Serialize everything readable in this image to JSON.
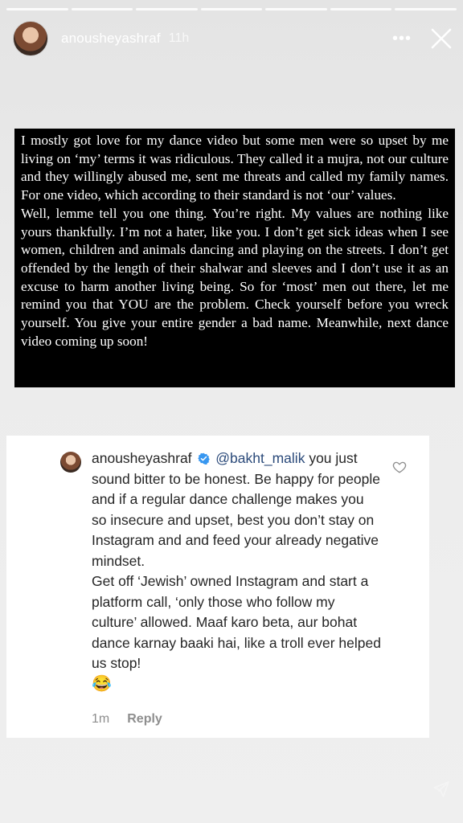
{
  "story": {
    "username": "anousheyashraf",
    "time": "11h",
    "progress_segments": 7
  },
  "quote": {
    "paragraphs": [
      "I mostly got love for my dance video but some men were so upset by me living on ‘my’ terms it was ridiculous. They called it a mujra, not our culture and they willingly abused me, sent me threats and called my family names. For one video, which according to their standard is not ‘our’ values.",
      "Well, lemme tell you one thing. You’re right. My values are nothing like yours thankfully. I’m not a hater, like you. I don’t get sick ideas when I see women, children and animals dancing and playing on the streets. I don’t get offended by the length of their shalwar and sleeves and I don’t use it as an excuse to harm another living being. So for ‘most’ men out there, let me remind you that YOU are the problem. Check yourself before you wreck yourself. You give your entire gender a bad name. Meanwhile, next dance video coming up soon!"
    ]
  },
  "comment": {
    "username": "anousheyashraf",
    "mention": "@bakht_malik",
    "text1": " you just sound bitter to be honest. Be happy for people and if a regular dance challenge makes you so insecure and upset, best you don’t stay on Instagram and and feed your already negative mindset.",
    "text2": "Get off ‘Jewish’ owned Instagram and start a platform call, ‘only those who follow my culture’ allowed. Maaf karo beta, aur bohat dance karnay baaki hai, like a troll ever helped us stop!",
    "emoji": "😂",
    "time": "1m",
    "reply_label": "Reply",
    "verified_color": "#3897f0"
  },
  "icons": {
    "more": "more-icon",
    "close": "close-icon",
    "heart": "heart-icon",
    "verified": "verified-badge-icon",
    "send": "send-icon"
  }
}
